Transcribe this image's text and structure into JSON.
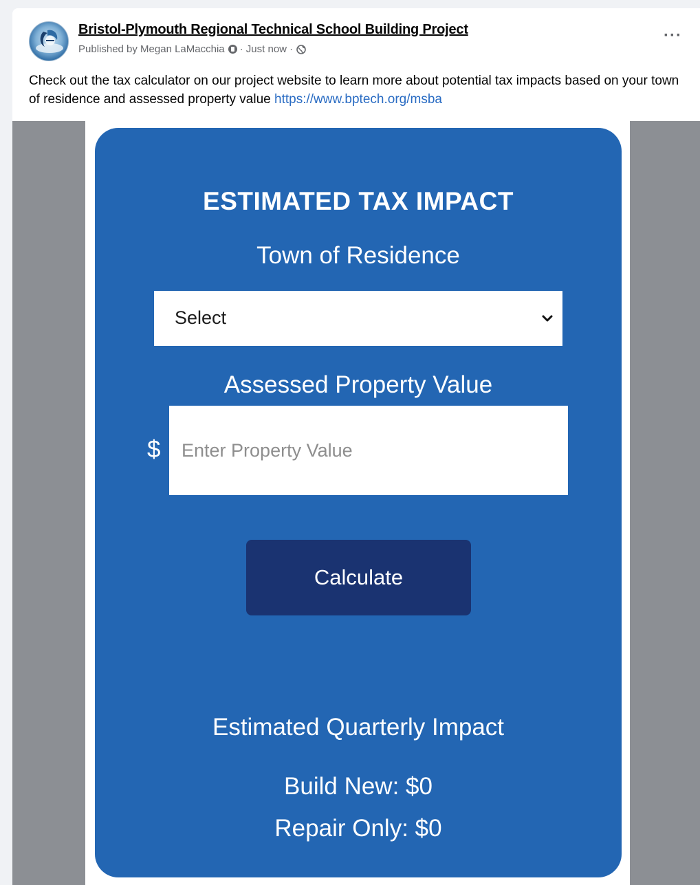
{
  "post": {
    "page_name": "Bristol-Plymouth Regional Technical School Building Project",
    "published_by": "Published by Megan LaMacchia",
    "time": "· Just now ·",
    "more_label": "···",
    "text": "Check out the tax calculator on our project website to learn more about potential tax impacts based on your town of residence and assessed property value ",
    "link": "https://www.bptech.org/msba"
  },
  "calculator": {
    "title": "ESTIMATED TAX IMPACT",
    "town_label": "Town of Residence",
    "town_select_value": "Select",
    "value_label": "Assessed Property Value",
    "currency_symbol": "$",
    "value_placeholder": "Enter Property Value",
    "button_label": "Calculate",
    "result_title": "Estimated Quarterly Impact",
    "build_new": "Build New: $0",
    "repair_only": "Repair Only: $0"
  },
  "colors": {
    "card_blue": "#2366b3",
    "button_navy": "#1a3371",
    "link_blue": "#2a6cc3"
  }
}
